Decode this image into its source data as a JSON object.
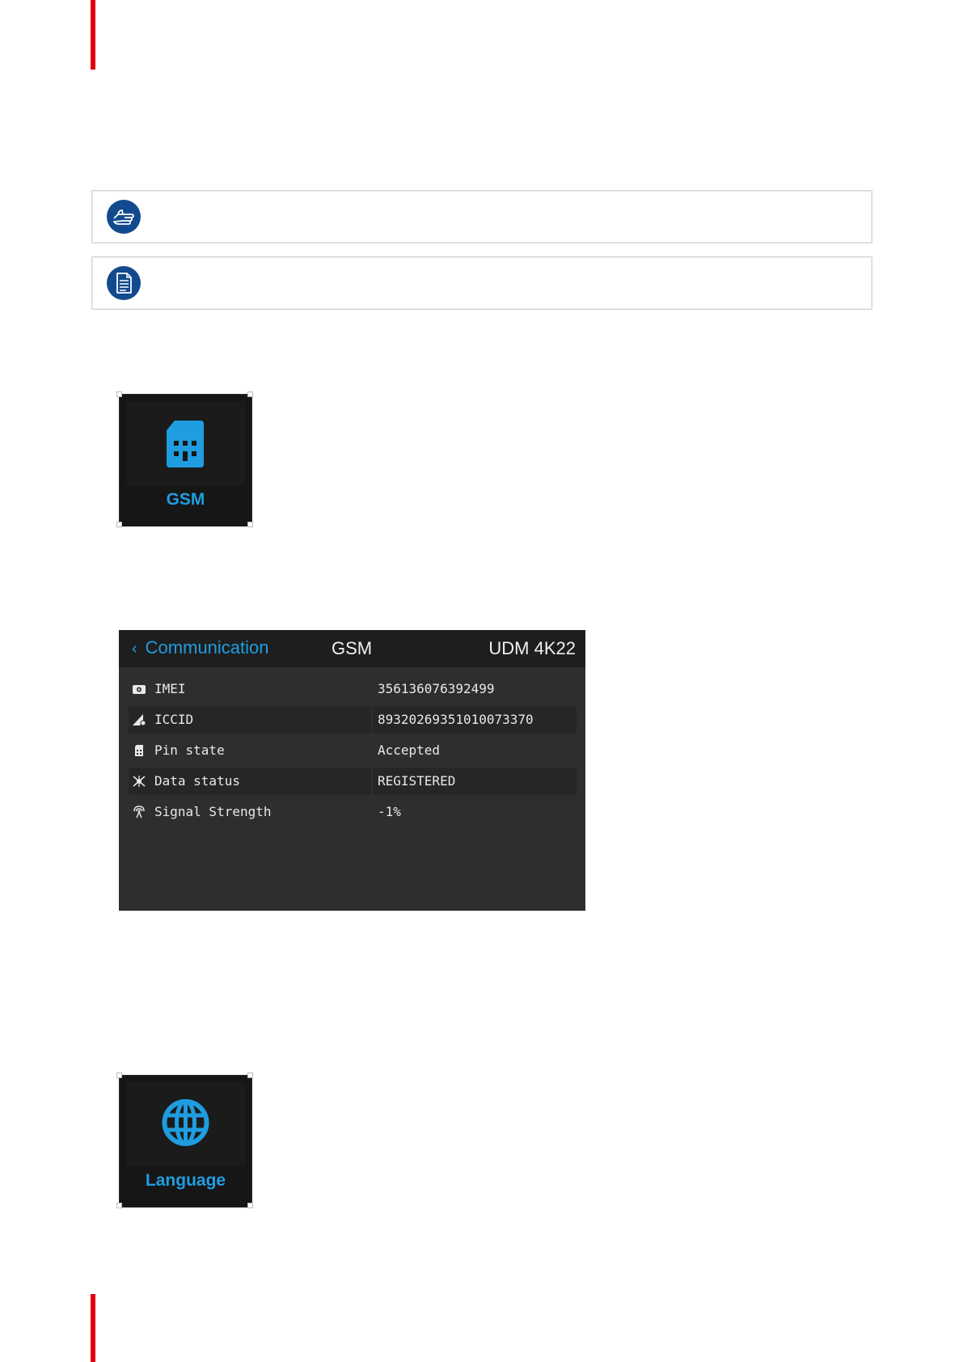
{
  "colors": {
    "accent_red": "#e2000f",
    "note_icon_blue": "#134a8e",
    "ui_accent": "#1f9de0"
  },
  "notes": [
    {
      "icon": "pointing-hand-icon"
    },
    {
      "icon": "document-icon"
    }
  ],
  "gsm_tile": {
    "icon": "sim-card-icon",
    "label": "GSM"
  },
  "gsm_panel": {
    "back_label": "Communication",
    "title": "GSM",
    "device": "UDM 4K22",
    "rows": [
      {
        "icon": "imei-icon",
        "label": "IMEI",
        "value": "356136076392499"
      },
      {
        "icon": "iccid-icon",
        "label": "ICCID",
        "value": "89320269351010073370"
      },
      {
        "icon": "sim-icon",
        "label": "Pin state",
        "value": "Accepted"
      },
      {
        "icon": "data-status-icon",
        "label": "Data status",
        "value": "REGISTERED"
      },
      {
        "icon": "antenna-icon",
        "label": "Signal Strength",
        "value": "-1%"
      }
    ]
  },
  "language_tile": {
    "icon": "globe-icon",
    "label": "Language"
  }
}
